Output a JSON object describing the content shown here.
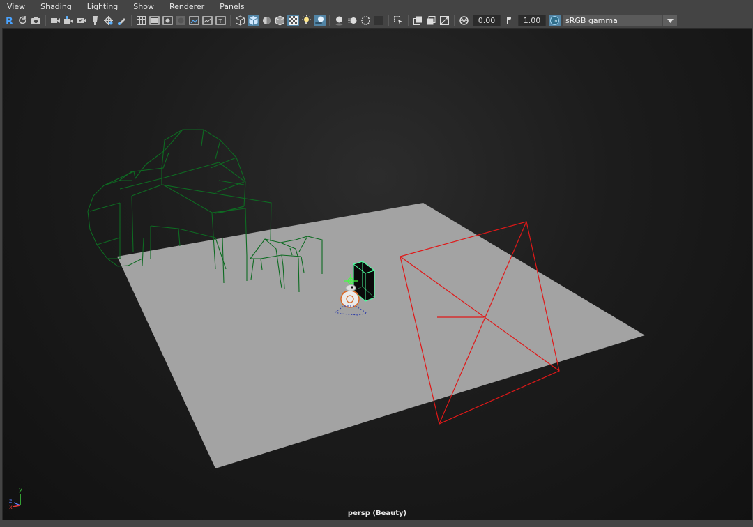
{
  "menu": [
    "View",
    "Shading",
    "Lighting",
    "Show",
    "Renderer",
    "Panels"
  ],
  "toolbar": {
    "exposure_value": "0.00",
    "gamma_value": "1.00",
    "color_space": "sRGB gamma",
    "icons": [
      "select-camera-icon",
      "camera-attributes-icon",
      "bookmarks-icon",
      "image-plane-icon",
      "2d-pan-zoom-icon",
      "grease-pencil-icon",
      "grid-icon",
      "film-gate-icon",
      "resolution-gate-icon",
      "gate-mask-icon",
      "field-chart-icon",
      "safe-action-icon",
      "safe-title-icon",
      "wireframe-icon",
      "smooth-shade-icon",
      "default-material-icon",
      "wireframe-on-shaded-icon",
      "xray-icon",
      "use-all-lights-icon",
      "shadows-icon",
      "screen-space-ao-icon",
      "motion-blur-icon",
      "multisample-aa-icon",
      "depth-of-field-icon",
      "isolate-select-icon",
      "xray-joints-icon",
      "xray-active-icon",
      "backface-icon",
      "exposure-icon",
      "gamma-icon",
      "color-management-icon"
    ],
    "accent": "#5285a6"
  },
  "viewport": {
    "camera_label": "persp (Beauty)",
    "axis_labels": [
      "x",
      "y",
      "z"
    ],
    "colors": {
      "ground": "#a3a3a3",
      "wire_green": "#0e6b22",
      "selected": "#4dff9e",
      "light_red": "#e01818"
    }
  }
}
